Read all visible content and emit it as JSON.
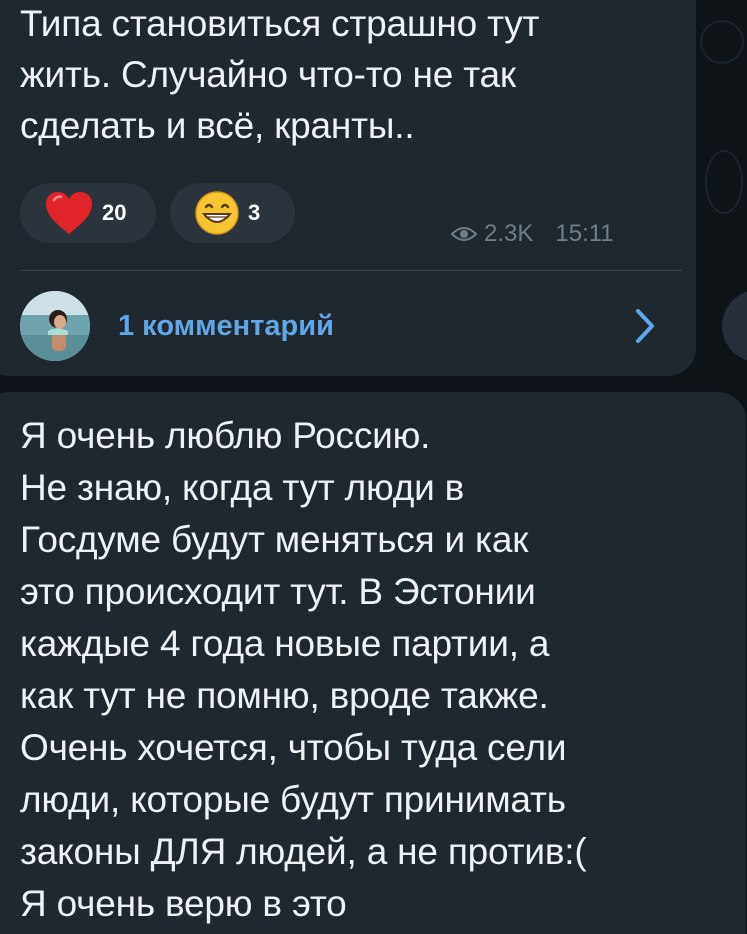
{
  "post": {
    "text": "Типа становиться страшно тут\nжить. Случайно что-то не так\nсделать и всё, кранты..",
    "reactions": [
      {
        "emoji": "heart-icon",
        "count": "20"
      },
      {
        "emoji": "grinning-face-icon",
        "count": "3"
      }
    ],
    "views": "2.3K",
    "time": "15:11",
    "comments_label": "1 комментарий"
  },
  "next_message": {
    "text": "Я очень люблю Россию.\nНе знаю, когда тут люди в\nГосдуме будут меняться и как\nэто происходит тут. В Эстонии\nкаждые 4 года новые партии, а\nкак тут не помню, вроде также.\nОчень хочется, чтобы туда сели\nлюди, которые будут принимать\nзаконы ДЛЯ людей, а не против:(\nЯ очень верю в это"
  },
  "colors": {
    "bubble": "#1f272f",
    "background": "#0e1318",
    "link": "#5fa8e8",
    "meta": "#6f7d88",
    "reaction_bg": "#2b343d"
  }
}
